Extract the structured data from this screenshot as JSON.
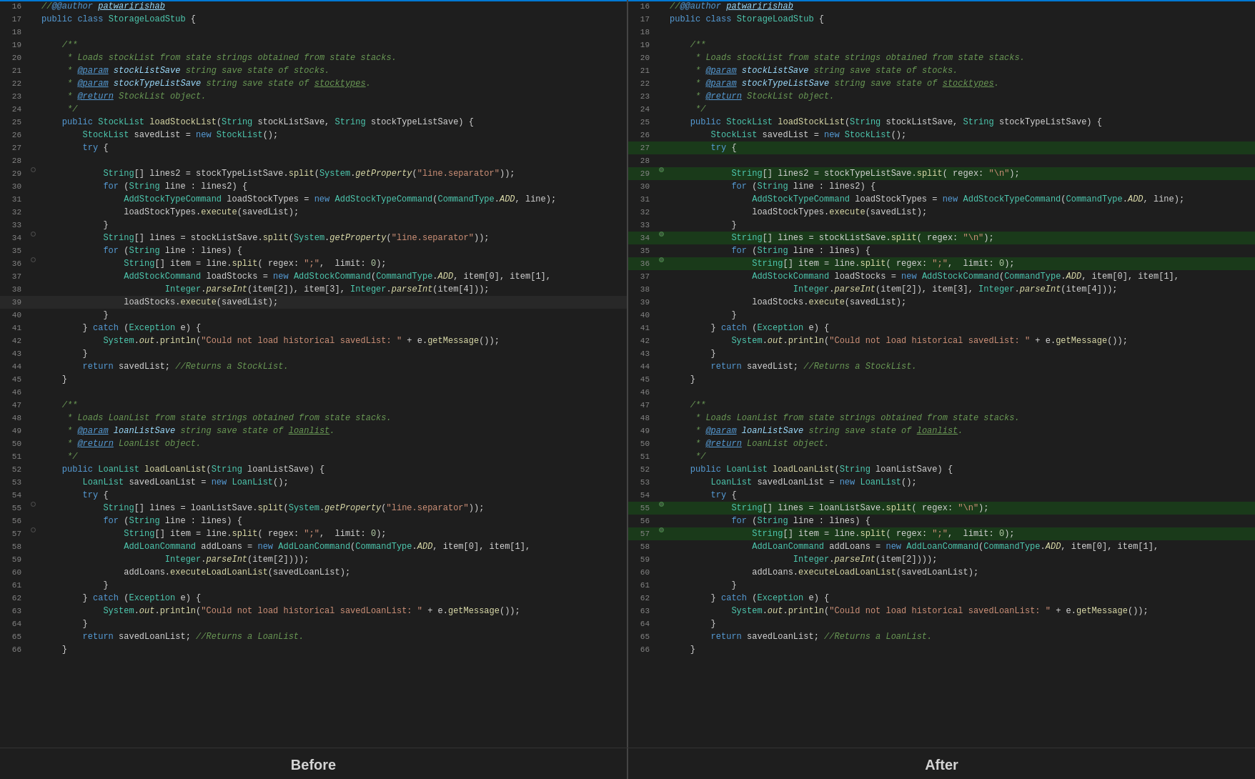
{
  "labels": {
    "before": "Before",
    "after": "After"
  },
  "colors": {
    "background": "#1e1e1e",
    "linenum": "#858585",
    "keyword": "#569cd6",
    "type": "#4ec9b0",
    "function": "#dcdcaa",
    "string": "#ce9178",
    "comment": "#6a9955",
    "variable": "#9cdcfe",
    "purple": "#c586c0"
  }
}
